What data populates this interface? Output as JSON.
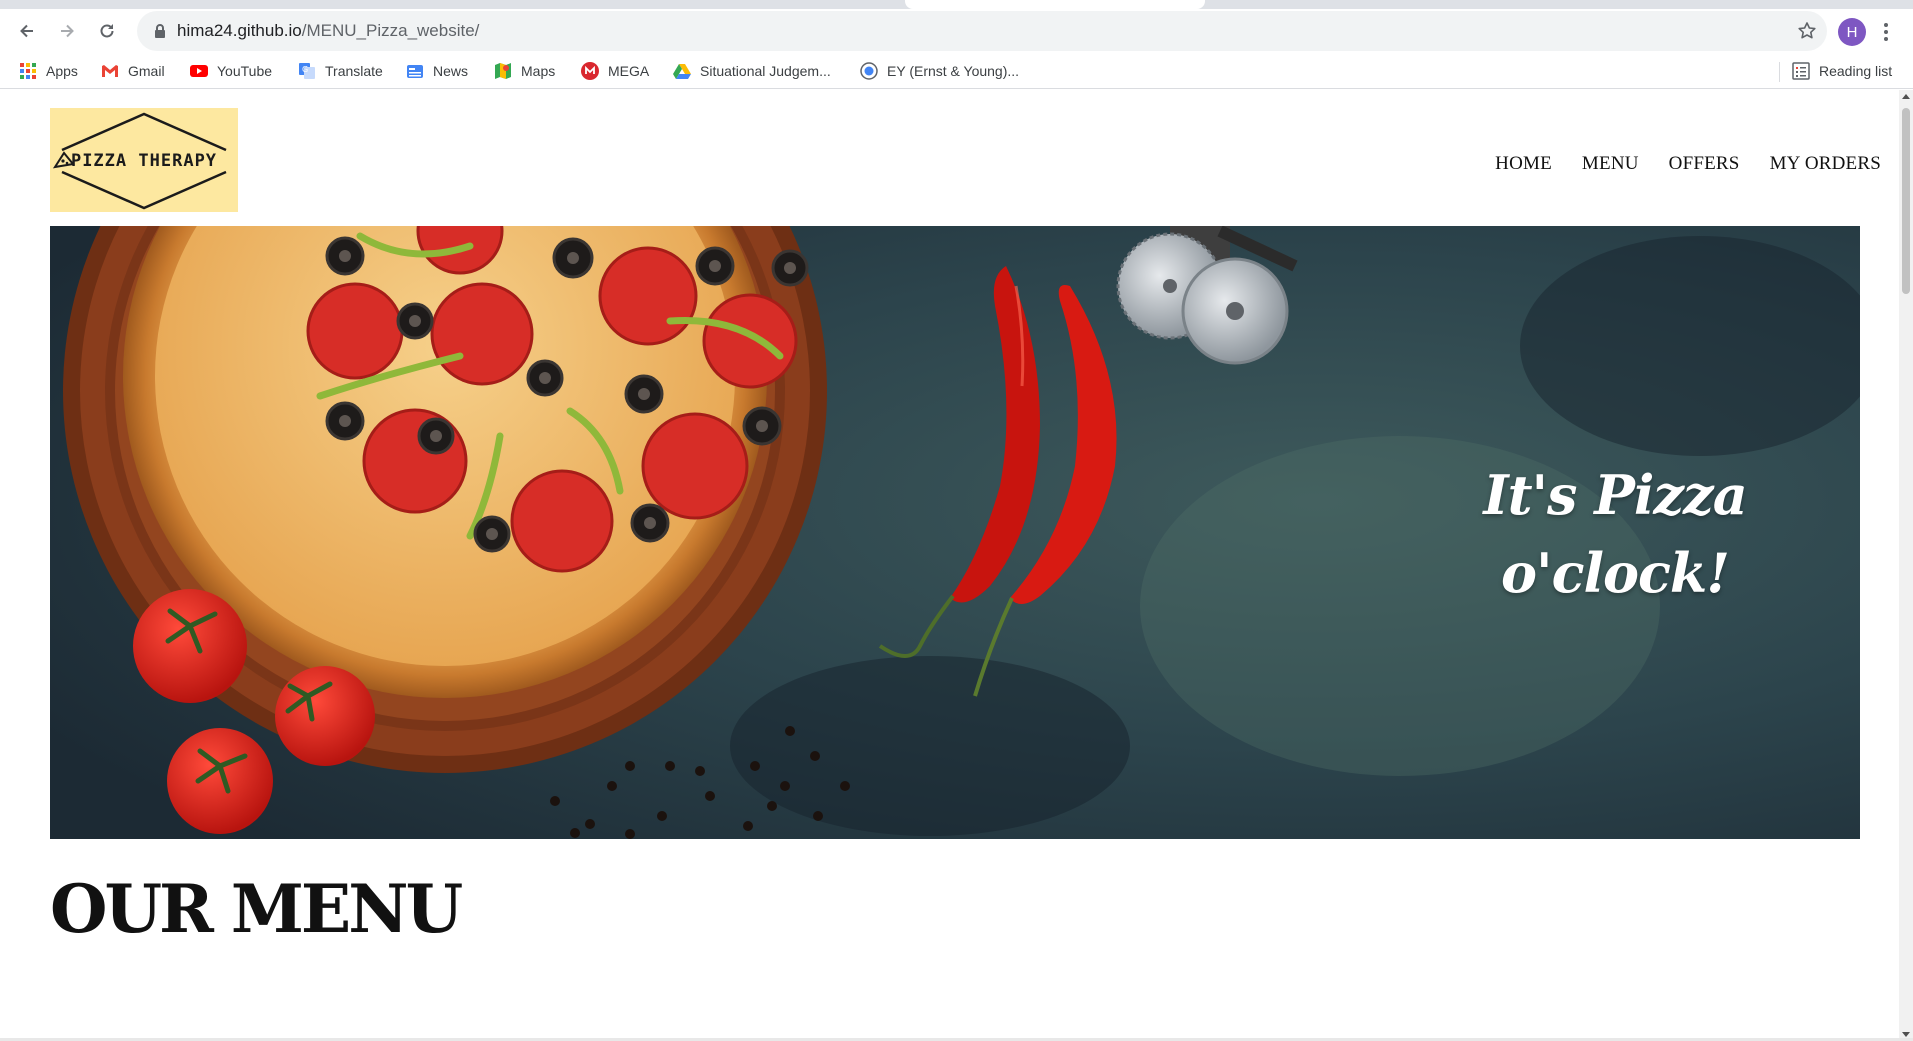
{
  "browser": {
    "url_host": "hima24.github.io",
    "url_path": "/MENU_Pizza_website/",
    "profile_initial": "H",
    "reading_list_label": "Reading list",
    "bookmarks": [
      {
        "label": "Apps",
        "icon": "apps-grid-icon"
      },
      {
        "label": "Gmail",
        "icon": "gmail-icon"
      },
      {
        "label": "YouTube",
        "icon": "youtube-icon"
      },
      {
        "label": "Translate",
        "icon": "translate-icon"
      },
      {
        "label": "News",
        "icon": "news-icon"
      },
      {
        "label": "Maps",
        "icon": "maps-icon"
      },
      {
        "label": "MEGA",
        "icon": "mega-icon"
      },
      {
        "label": "Situational Judgem...",
        "icon": "drive-icon"
      },
      {
        "label": "EY (Ernst & Young)...",
        "icon": "globe-icon"
      }
    ]
  },
  "site": {
    "logo_left": "PIZZA",
    "logo_right": "THERAPY",
    "nav": [
      "HOME",
      "MENU",
      "OFFERS",
      "MY ORDERS"
    ],
    "hero_line1": "It's Pizza",
    "hero_line2": "o'clock!",
    "section_title": "OUR MENU"
  },
  "colors": {
    "logo_background": "#fde8a0",
    "hero_background": "#2a3a42",
    "profile_avatar": "#7e57c2",
    "text": "#111111"
  }
}
